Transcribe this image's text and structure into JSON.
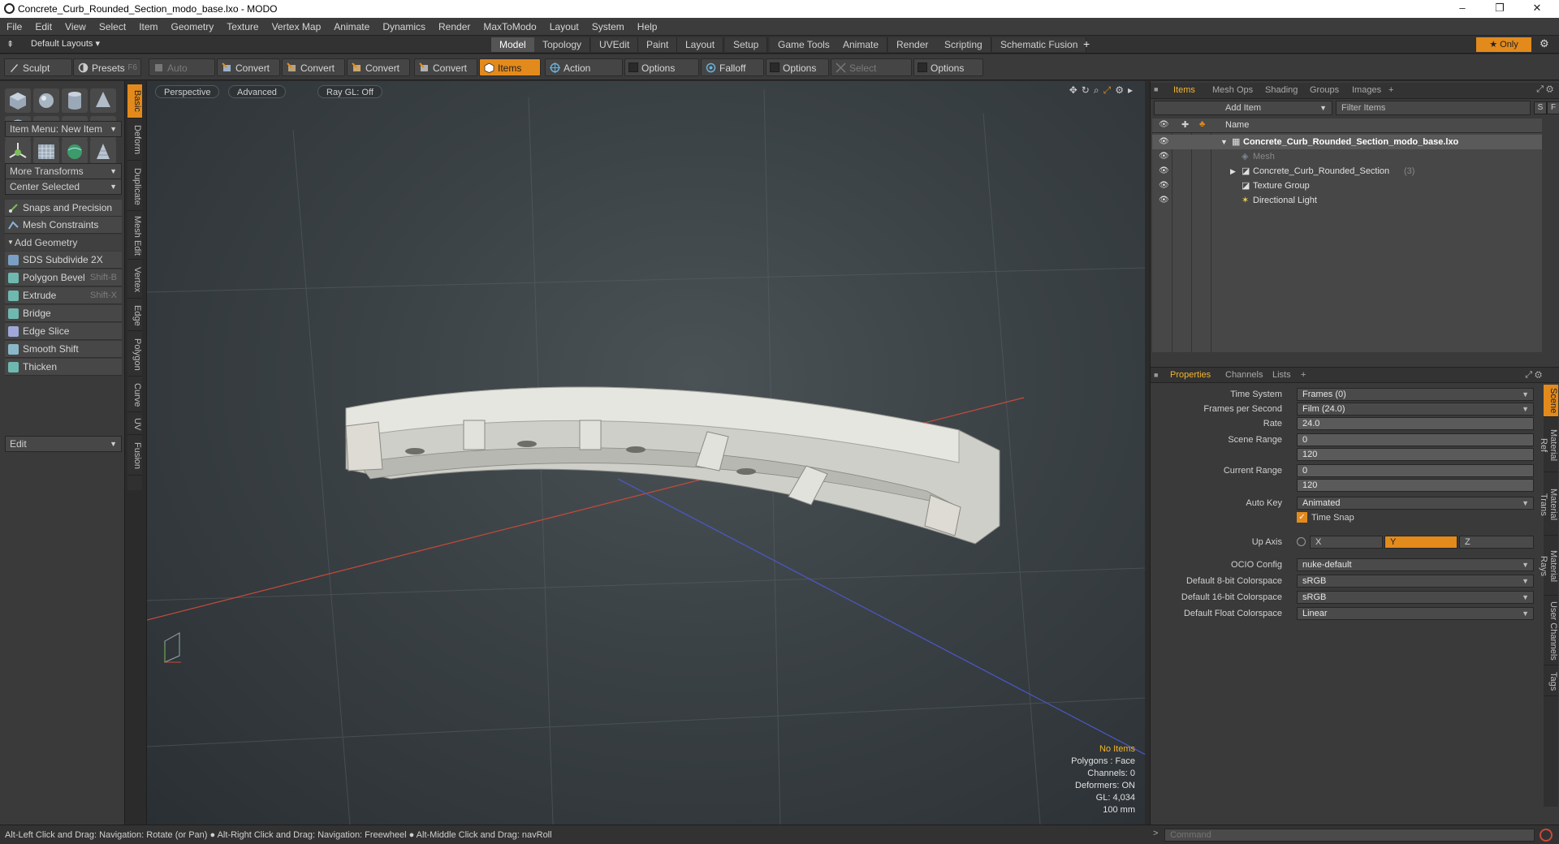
{
  "window": {
    "title": "Concrete_Curb_Rounded_Section_modo_base.lxo - MODO",
    "controls": [
      "–",
      "❐",
      "✕"
    ]
  },
  "menu": [
    "File",
    "Edit",
    "View",
    "Select",
    "Item",
    "Geometry",
    "Texture",
    "Vertex Map",
    "Animate",
    "Dynamics",
    "Render",
    "MaxToModo",
    "Layout",
    "System",
    "Help"
  ],
  "layout_bar": {
    "layouts_label": "Default Layouts ▾",
    "tabs": [
      "Model",
      "Topology",
      "UVEdit",
      "Paint",
      "Layout",
      "Setup",
      "Game Tools",
      "Animate",
      "Render",
      "Scripting",
      "Schematic Fusion"
    ],
    "active_tab": "Model",
    "plus": "+",
    "only_label": "★  Only"
  },
  "toolbar": {
    "sculpt": "Sculpt",
    "presets": "Presets",
    "presets_shortcut": "F6",
    "auto_select": "Auto Select",
    "convert": "Convert",
    "items": "Items",
    "action_center": "Action Center",
    "options": "Options",
    "falloff": "Falloff",
    "select_through": "Select Through"
  },
  "left_panel": {
    "item_menu": "Item Menu: New Item",
    "more_transforms": "More Transforms",
    "center_selected": "Center Selected",
    "snaps": "Snaps and Precision",
    "mesh_constraints": "Mesh Constraints",
    "add_geometry": "Add Geometry",
    "tools": [
      {
        "label": "SDS Subdivide 2X",
        "shortcut": ""
      },
      {
        "label": "Polygon Bevel",
        "shortcut": "Shift-B"
      },
      {
        "label": "Extrude",
        "shortcut": "Shift-X"
      },
      {
        "label": "Bridge",
        "shortcut": ""
      },
      {
        "label": "Edge Slice",
        "shortcut": ""
      },
      {
        "label": "Smooth Shift",
        "shortcut": ""
      },
      {
        "label": "Thicken",
        "shortcut": ""
      }
    ],
    "edit": "Edit",
    "vtabs": [
      "Basic",
      "Deform",
      "Duplicate",
      "Mesh Edit",
      "Vertex",
      "Edge",
      "Polygon",
      "Curve",
      "UV",
      "Fusion"
    ]
  },
  "viewport": {
    "tabs": [
      "Perspective",
      "Advanced",
      "Ray GL: Off"
    ],
    "info": {
      "selection": "No Items",
      "polygons": "Polygons : Face",
      "channels": "Channels: 0",
      "deformers": "Deformers: ON",
      "gl": "GL: 4,034",
      "scale": "100 mm"
    }
  },
  "status_bar": "Alt-Left Click and Drag: Navigation: Rotate (or Pan) ● Alt-Right Click and Drag: Navigation: Freewheel ● Alt-Middle Click and Drag: navRoll",
  "items_panel": {
    "tabs": [
      "Items",
      "Mesh Ops",
      "Shading",
      "Groups",
      "Images",
      "+"
    ],
    "add_item": "Add Item",
    "filter": "Filter Items",
    "s_btn": "S",
    "f_btn": "F",
    "column_name": "Name",
    "tree": [
      {
        "label": "Concrete_Curb_Rounded_Section_modo_base.lxo",
        "suffix": ""
      },
      {
        "label": "Mesh",
        "suffix": ""
      },
      {
        "label": "Concrete_Curb_Rounded_Section",
        "suffix": "(3)"
      },
      {
        "label": "Texture Group",
        "suffix": ""
      },
      {
        "label": "Directional Light",
        "suffix": ""
      }
    ]
  },
  "properties_panel": {
    "tabs": [
      "Properties",
      "Channels",
      "Lists",
      "+"
    ],
    "rows": {
      "time_system": {
        "label": "Time System",
        "value": "Frames (0)"
      },
      "fps": {
        "label": "Frames per Second",
        "value": "Film (24.0)"
      },
      "rate": {
        "label": "Rate",
        "value": "24.0"
      },
      "scene_range": {
        "label": "Scene Range",
        "start": "0",
        "end": "120"
      },
      "current_range": {
        "label": "Current Range",
        "start": "0",
        "end": "120"
      },
      "auto_key": {
        "label": "Auto Key",
        "value": "Animated"
      },
      "time_snap": {
        "label": "Time Snap"
      },
      "up_axis": {
        "label": "Up Axis",
        "x": "X",
        "y": "Y",
        "z": "Z"
      },
      "ocio": {
        "label": "OCIO Config",
        "value": "nuke-default"
      },
      "cs8": {
        "label": "Default 8-bit Colorspace",
        "value": "sRGB"
      },
      "cs16": {
        "label": "Default 16-bit Colorspace",
        "value": "sRGB"
      },
      "csf": {
        "label": "Default Float Colorspace",
        "value": "Linear"
      }
    },
    "vtabs": [
      "Scene",
      "Material Ref",
      "Material Trans",
      "Material Rays",
      "User Channels",
      "Tags"
    ]
  },
  "command": {
    "placeholder": "Command"
  },
  "colors": {
    "accent": "#e38a1c",
    "highlight_text": "#f2b52e"
  }
}
